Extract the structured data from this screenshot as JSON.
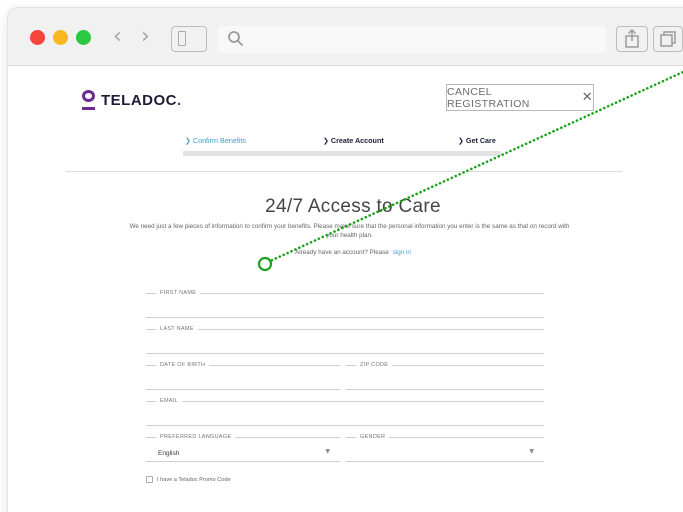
{
  "browser": {
    "back_icon": "chevron-left-icon",
    "forward_icon": "chevron-right-icon",
    "sidebar_icon": "sidebar-icon",
    "search_icon": "magnifier-icon",
    "share_icon": "share-icon",
    "tabs_icon": "tabs-icon",
    "traffic_light_colors": [
      "#f7453b",
      "#f8b920",
      "#2bc840"
    ]
  },
  "header": {
    "brand": "TELADOC",
    "brand_period": ".",
    "brand_color": "#6a2c91",
    "cancel_label": "CANCEL REGISTRATION",
    "cancel_icon": "close-icon"
  },
  "steps": [
    {
      "label": "Confirm Benefits",
      "active": true
    },
    {
      "label": "Create Account",
      "active": false
    },
    {
      "label": "Get Care",
      "active": false
    }
  ],
  "main": {
    "title": "24/7 Access to Care",
    "intro": "We need just a few pieces of information to confirm your benefits. Please make sure that the personal information you enter is the same as that on record with your health plan.",
    "signin_prefix": "Already have an account? Please",
    "signin_link": "sign in"
  },
  "form": {
    "first_name_label": "FIRST NAME",
    "last_name_label": "LAST NAME",
    "dob_label": "DATE OF BIRTH",
    "zip_label": "ZIP CODE",
    "email_label": "EMAIL",
    "language_label": "PREFERRED LANGUAGE",
    "language_value": "English",
    "gender_label": "GENDER",
    "gender_value": "",
    "promo_label": "I have a Teladoc Promo Code"
  },
  "colors": {
    "accent": "#3aa0c8",
    "annotation_green": "#1aa31a"
  }
}
